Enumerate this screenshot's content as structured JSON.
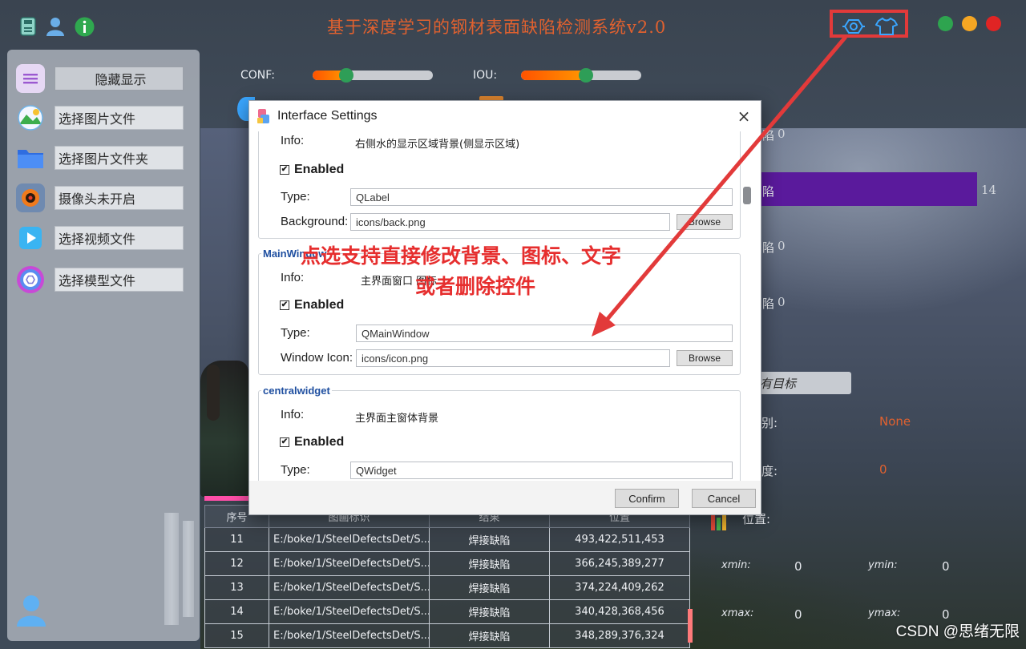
{
  "app": {
    "title": "基于深度学习的钢材表面缺陷检测系统v2.0"
  },
  "sidebar": {
    "toggle_label": "隐藏显示",
    "items": [
      {
        "label": "选择图片文件",
        "icon": "image-icon"
      },
      {
        "label": "选择图片文件夹",
        "icon": "folder-icon"
      },
      {
        "label": "摄像头未开启",
        "icon": "camera-icon"
      },
      {
        "label": "选择视频文件",
        "icon": "video-icon"
      },
      {
        "label": "选择模型文件",
        "icon": "model-icon"
      }
    ]
  },
  "sliders": {
    "conf_label": "CONF:",
    "conf_value": 0.28,
    "iou_label": "IOU:",
    "iou_value": 0.54
  },
  "stats": {
    "rows": [
      {
        "label": "陷",
        "value": "0"
      },
      {
        "label": "陷",
        "value": "14"
      },
      {
        "label": "陷",
        "value": "0"
      },
      {
        "label": "陷",
        "value": "0"
      }
    ],
    "target_button": "有目标",
    "class_label": "别:",
    "class_value": "None",
    "conf_label": "度:",
    "conf_value": "0",
    "pos_label": "位置:",
    "xmin_label": "xmin:",
    "xmin_value": "0",
    "ymin_label": "ymin:",
    "ymin_value": "0",
    "xmax_label": "xmax:",
    "xmax_value": "0",
    "ymax_label": "ymax:",
    "ymax_value": "0"
  },
  "table": {
    "headers": [
      "序号",
      "图画标识",
      "结果",
      "位置"
    ],
    "rows": [
      [
        "11",
        "E:/boke/1/SteelDefectsDet/S...",
        "焊接缺陷",
        "493,422,511,453"
      ],
      [
        "12",
        "E:/boke/1/SteelDefectsDet/S...",
        "焊接缺陷",
        "366,245,389,277"
      ],
      [
        "13",
        "E:/boke/1/SteelDefectsDet/S...",
        "焊接缺陷",
        "374,224,409,262"
      ],
      [
        "14",
        "E:/boke/1/SteelDefectsDet/S...",
        "焊接缺陷",
        "340,428,368,456"
      ],
      [
        "15",
        "E:/boke/1/SteelDefectsDet/S...",
        "焊接缺陷",
        "348,289,376,324"
      ]
    ]
  },
  "dialog": {
    "title": "Interface Settings",
    "close": "×",
    "top_group": {
      "info_label": "Info:",
      "info_value": "右侧水的显示区域背景(侧显示区域)",
      "enabled_label": "Enabled",
      "type_label": "Type:",
      "type_value": "QLabel",
      "bg_label": "Background:",
      "bg_value": "icons/back.png",
      "browse": "Browse"
    },
    "main_group": {
      "title": "MainWindow",
      "info_label": "Info:",
      "info_value": "主界面窗口 图标",
      "enabled_label": "Enabled",
      "type_label": "Type:",
      "type_value": "QMainWindow",
      "icon_label": "Window Icon:",
      "icon_value": "icons/icon.png",
      "browse": "Browse"
    },
    "central_group": {
      "title": "centralwidget",
      "info_label": "Info:",
      "info_value": "主界面主窗体背景",
      "enabled_label": "Enabled",
      "type_label": "Type:",
      "type_value": "QWidget"
    },
    "confirm": "Confirm",
    "cancel": "Cancel"
  },
  "annotation": {
    "line1": "点选支持直接修改背景、图标、文字",
    "line2": "或者删除控件"
  },
  "watermark": "CSDN @思绪无限",
  "colors": {
    "accent_red": "#e23a3a",
    "title_orange": "#e0612f",
    "bar_purple": "#5a1a9c"
  }
}
